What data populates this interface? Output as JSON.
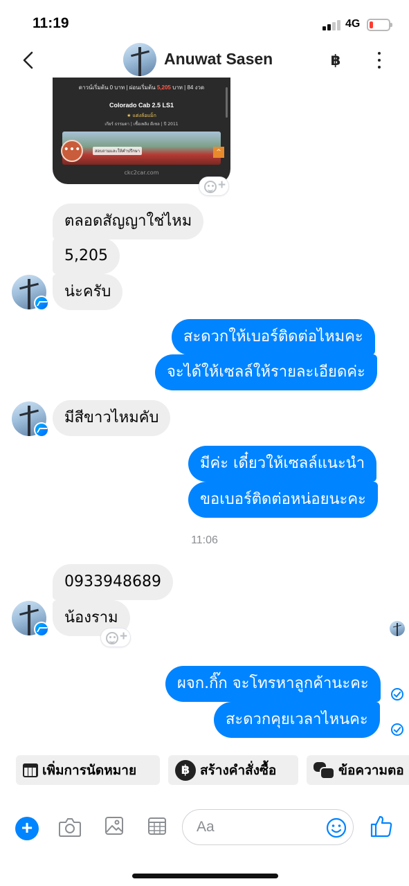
{
  "status_bar": {
    "time": "11:19",
    "network": "4G"
  },
  "header": {
    "contact_name": "Anuwat Sasen",
    "currency_symbol": "฿"
  },
  "media_card": {
    "price_line_prefix": "ดาวน์เริ่มต้น 0 บาท | ผ่อนเริ่มต้น",
    "price_value": "5,205",
    "price_line_suffix": "บาท | 84 งวด",
    "model": "Colorado Cab 2.5 LS1",
    "tag": "★ แต่งล้อแม็ก",
    "info": "เกียร์ ธรรมดา | เชื้อเพลิง ดีเซล | ปี 2011",
    "cta": "สอบถามและให้คำปรึกษา",
    "url": "ckc2car.com"
  },
  "messages": [
    {
      "id": "m1",
      "side": "in",
      "text": "ตลอดสัญญาใช่ไหม"
    },
    {
      "id": "m2",
      "side": "in",
      "text": "5,205"
    },
    {
      "id": "m3",
      "side": "in",
      "text": "น่ะครับ"
    },
    {
      "id": "m4",
      "side": "out",
      "text": "สะดวกให้เบอร์ติดต่อไหมคะ"
    },
    {
      "id": "m5",
      "side": "out",
      "text": "จะได้ให้เซลล์ให้รายละเอียดค่ะ"
    },
    {
      "id": "m6",
      "side": "in",
      "text": "มีสีขาวไหมคับ"
    },
    {
      "id": "m7",
      "side": "out",
      "text": "มีค่ะ เดี๋ยวให้เซลล์แนะนำ"
    },
    {
      "id": "m8",
      "side": "out",
      "text": "ขอเบอร์ติดต่อหน่อยนะคะ"
    },
    {
      "id": "m9",
      "side": "in",
      "text": "0933948689"
    },
    {
      "id": "m10",
      "side": "in",
      "text": "น้องราม"
    },
    {
      "id": "m11",
      "side": "out",
      "text": "ผจก.กิ๊ก จะโทรหาลูกค้านะคะ"
    },
    {
      "id": "m12",
      "side": "out",
      "text": "สะดวกคุยเวลาไหนคะ"
    }
  ],
  "timestamp": "11:06",
  "quick_actions": [
    {
      "label": "เพิ่มการนัดหมาย",
      "icon": "calendar-icon"
    },
    {
      "label": "สร้างคำสั่งซื้อ",
      "icon": "baht-icon",
      "icon_text": "฿"
    },
    {
      "label": "ข้อความตอ",
      "icon": "messages-icon"
    }
  ],
  "composer": {
    "placeholder": "Aa"
  },
  "colors": {
    "accent": "#0084ff",
    "incoming_bubble": "#eeeeee",
    "battery_low": "#ff3b30"
  }
}
